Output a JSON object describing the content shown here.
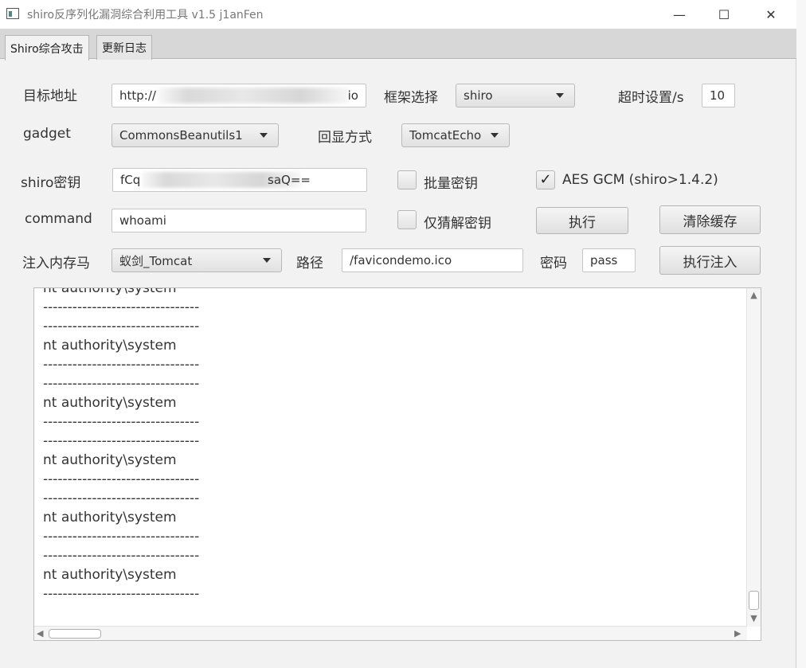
{
  "window": {
    "title": "shiro反序列化漏洞综合利用工具 v1.5  j1anFen",
    "minimize": "—",
    "maximize": "☐",
    "close": "✕"
  },
  "tabs": [
    {
      "label": "Shiro综合攻击",
      "active": true
    },
    {
      "label": "更新日志",
      "active": false
    }
  ],
  "form": {
    "target_label": "目标地址",
    "target_prefix": "http://",
    "target_suffix": "io",
    "framework_label": "框架选择",
    "framework_value": "shiro",
    "timeout_label": "超时设置/s",
    "timeout_value": "10",
    "gadget_label": "gadget",
    "gadget_value": "CommonsBeanutils1",
    "echo_label": "回显方式",
    "echo_value": "TomcatEcho",
    "key_label": "shiro密钥",
    "key_prefix": "fCq",
    "key_suffix": "saQ==",
    "batch_key_label": "批量密钥",
    "batch_key_checked": false,
    "aes_gcm_label": "AES GCM (shiro>1.4.2)",
    "aes_gcm_checked": true,
    "command_label": "command",
    "command_value": "whoami",
    "guess_key_label": "仅猜解密钥",
    "guess_key_checked": false,
    "execute_button": "执行",
    "clear_cache_button": "清除缓存",
    "memshell_label": "注入内存马",
    "memshell_value": "蚁剑_Tomcat",
    "path_label": "路径",
    "path_value": "/favicondemo.ico",
    "password_label": "密码",
    "password_value": "pass",
    "inject_button": "执行注入"
  },
  "output": {
    "lines": [
      "nt authority\\system",
      "--------------------------------",
      "--------------------------------",
      "nt authority\\system",
      "--------------------------------",
      "--------------------------------",
      "nt authority\\system",
      "--------------------------------",
      "--------------------------------",
      "nt authority\\system",
      "--------------------------------",
      "--------------------------------",
      "nt authority\\system",
      "--------------------------------",
      "--------------------------------",
      "nt authority\\system",
      "--------------------------------"
    ]
  },
  "scroll": {
    "up": "▲",
    "down": "▼",
    "left": "◀",
    "right": "▶"
  }
}
